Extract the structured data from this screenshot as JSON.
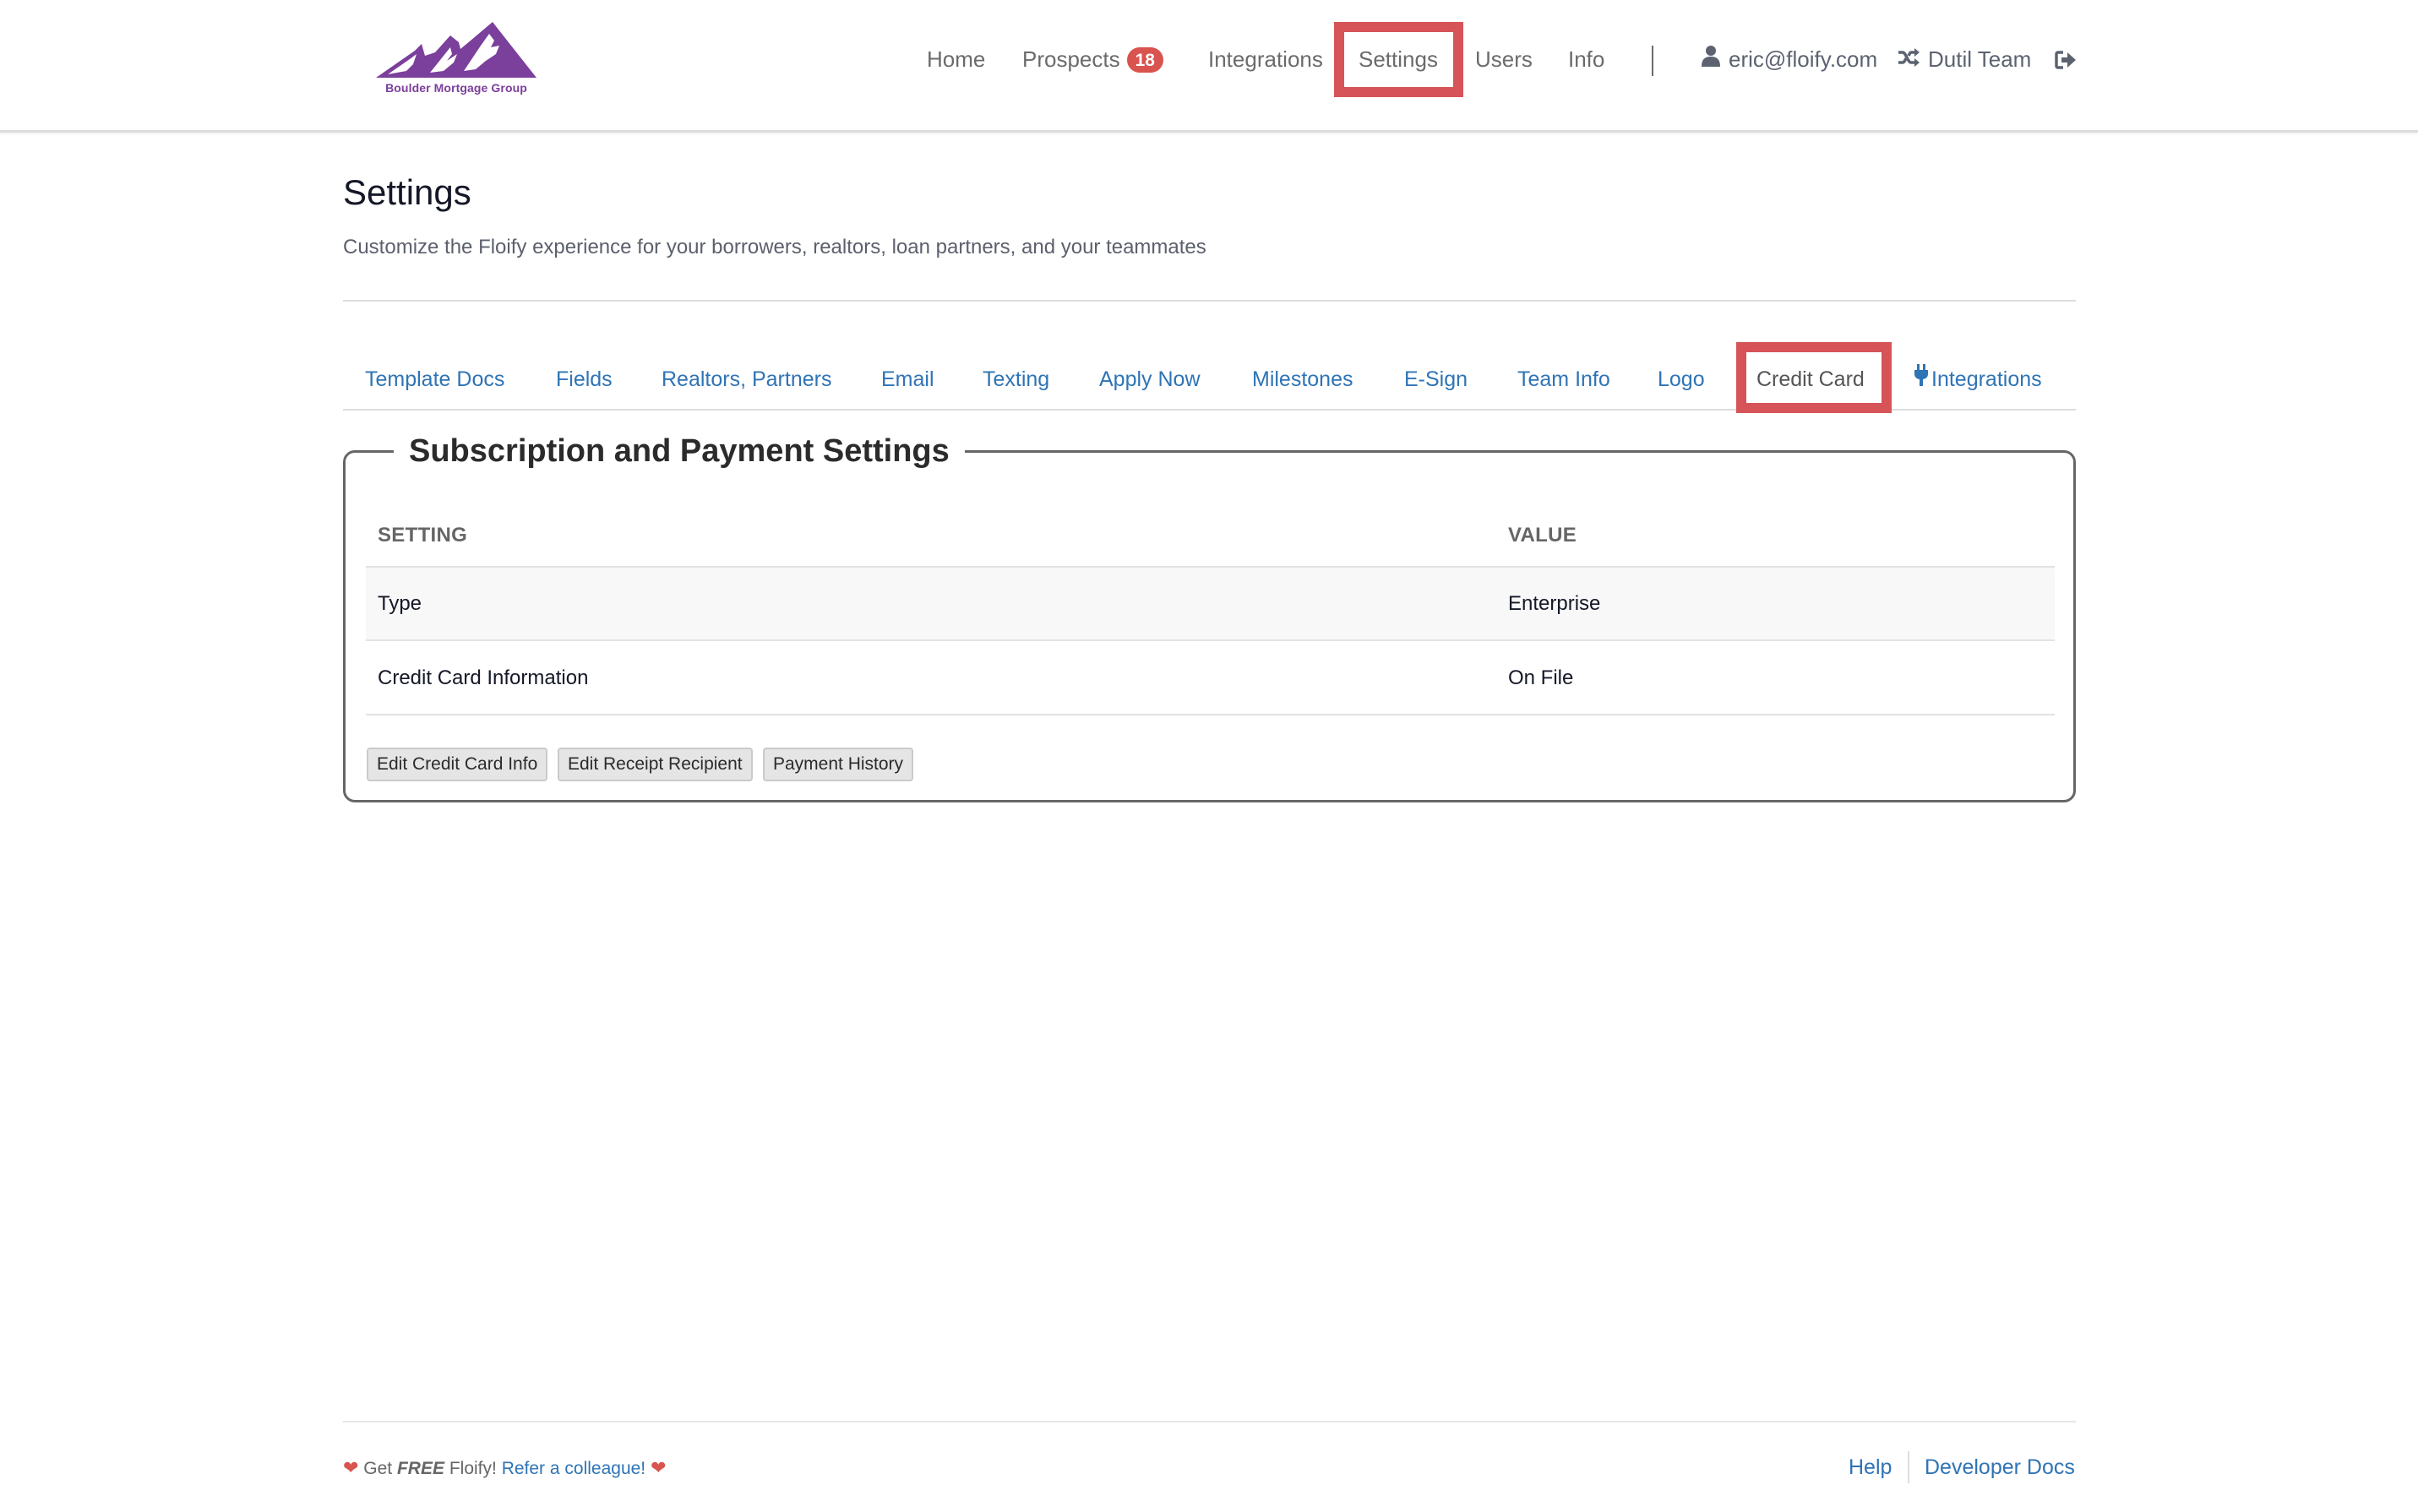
{
  "header": {
    "logo_text": "Boulder Mortgage Group",
    "nav": [
      {
        "label": "Home"
      },
      {
        "label": "Prospects",
        "badge": "18"
      },
      {
        "label": "Integrations"
      },
      {
        "label": "Settings",
        "highlighted": true
      },
      {
        "label": "Users"
      },
      {
        "label": "Info"
      }
    ],
    "user_email": "eric@floify.com",
    "team": "Dutil Team",
    "icons": {
      "user": "user-icon",
      "switch_team": "shuffle-icon",
      "logout": "sign-out-icon"
    }
  },
  "page": {
    "title": "Settings",
    "subtitle": "Customize the Floify experience for your borrowers, realtors, loan partners, and your teammates"
  },
  "tabs": [
    {
      "label": "Template Docs"
    },
    {
      "label": "Fields"
    },
    {
      "label": "Realtors, Partners"
    },
    {
      "label": "Email"
    },
    {
      "label": "Texting"
    },
    {
      "label": "Apply Now"
    },
    {
      "label": "Milestones"
    },
    {
      "label": "E-Sign"
    },
    {
      "label": "Team Info"
    },
    {
      "label": "Logo"
    },
    {
      "label": "Credit Card",
      "active": true
    },
    {
      "label": "Integrations",
      "icon": "plug-icon"
    }
  ],
  "subscription": {
    "legend": "Subscription and Payment Settings",
    "columns": [
      "SETTING",
      "VALUE"
    ],
    "rows": [
      {
        "setting": "Type",
        "value": "Enterprise"
      },
      {
        "setting": "Credit Card Information",
        "value": "On File"
      }
    ],
    "buttons": [
      "Edit Credit Card Info",
      "Edit Receipt Recipient",
      "Payment History"
    ]
  },
  "footer": {
    "get": "Get",
    "free": "FREE",
    "floify": "Floify!",
    "refer_link": "Refer a colleague!",
    "help": "Help",
    "developer_docs": "Developer Docs"
  },
  "colors": {
    "brand_purple": "#7b3f9c",
    "link_blue": "#2f74b5",
    "badge_red": "#d9534f",
    "highlight_red": "#d65457"
  }
}
